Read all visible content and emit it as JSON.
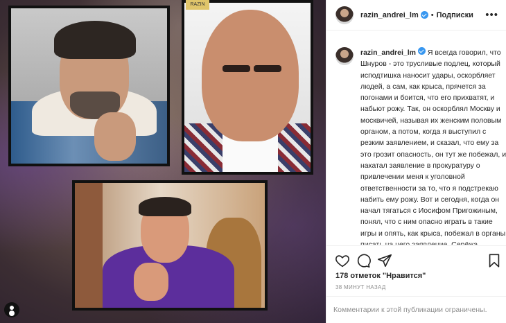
{
  "post": {
    "username": "razin_andrei_lm",
    "follow_label": "Подписки",
    "separator": "•",
    "more_label": "•••",
    "caption_text": "Я всегда говорил, что Шнуров - это трусливые подлец, который исподтишка наносит удары, оскорбляет людей, а сам, как крыса, прячется за погонами и боится, что его прихватят, и набьют рожу. Так, он оскорблял Москву и москвичей, называя их женским половым органом, а потом, когда я выступил с резким заявлением, и сказал, что ему за это грозит опасность, он тут же побежал, и накатал заявление в прокуратуру о привлечении меня к уголовной ответственности за то, что я подстрекаю набить ему рожу. Вот и сегодня, когда он начал тягаться с Иосифом Пригожиным, понял, что с ним опасно играть в такие игры и опять, как крыса, побежал в органы писать на него заявление. Серёжа.",
    "likes": "178 отметок \"Нравится\"",
    "time": "38 МИНУТ НАЗАД",
    "comments_disabled": "Комментарии к этой публикации ограничены."
  },
  "media": {
    "watermark": "RAZIN"
  },
  "icons": {
    "like": "heart-icon",
    "comment": "comment-icon",
    "share": "share-icon",
    "save": "bookmark-icon",
    "verified": "verified-badge-icon",
    "info": "user-tag-icon"
  },
  "colors": {
    "verified": "#3897f0",
    "muted": "#8e8e8e",
    "text": "#262626"
  }
}
